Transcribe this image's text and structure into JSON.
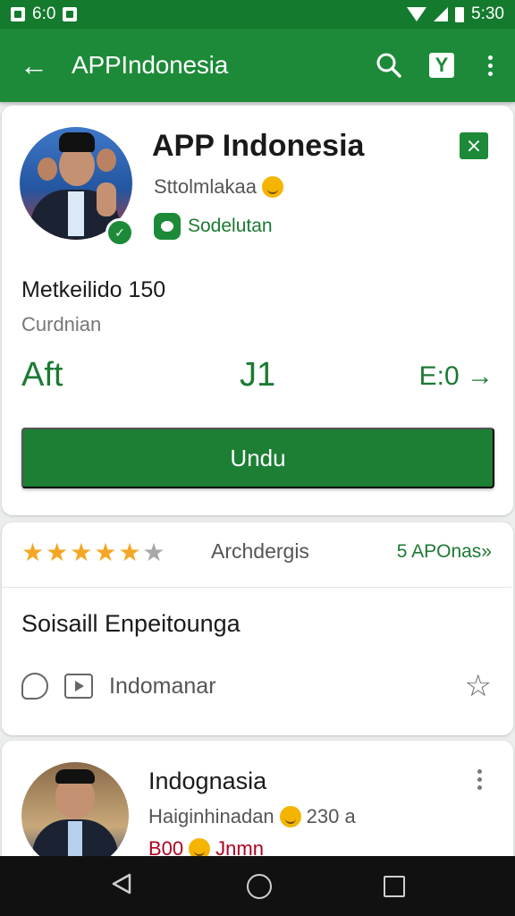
{
  "status_bar": {
    "time_left": "6:0",
    "time_right": "5:30"
  },
  "app_bar": {
    "back_icon": "arrow-back-icon",
    "title": "APPIndonesia",
    "search_icon": "search-icon",
    "badge_icon": "Y",
    "menu_icon": "more-vert-icon",
    "color": "#1c8a38"
  },
  "app_card": {
    "name": "APP Indonesia",
    "subtitle": "Sttolmlakaa",
    "tag": "Sodelutan",
    "external_icon": "open-external-icon",
    "meta_line1": "Metkeilido 150",
    "meta_line2": "Curdnian",
    "stats": [
      "Aft",
      "J1",
      "E:0 →"
    ],
    "download_label": "Undu"
  },
  "rating_card": {
    "rating": 4.5,
    "stars_max": 5,
    "rating_label": "Archdergis",
    "rating_link": "5 APOnas»",
    "section_title": "Soisaill Enpeitounga",
    "action_label": "Indomanar"
  },
  "person_card": {
    "name": "Indognasia",
    "subtitle": "Haiginhinadan",
    "subtitle_extra": "230 a",
    "badge_text": "B00",
    "badge_text2": "Jnmn"
  },
  "nav": {
    "back": "nav-back-icon",
    "home": "nav-home-icon",
    "recents": "nav-recents-icon"
  }
}
